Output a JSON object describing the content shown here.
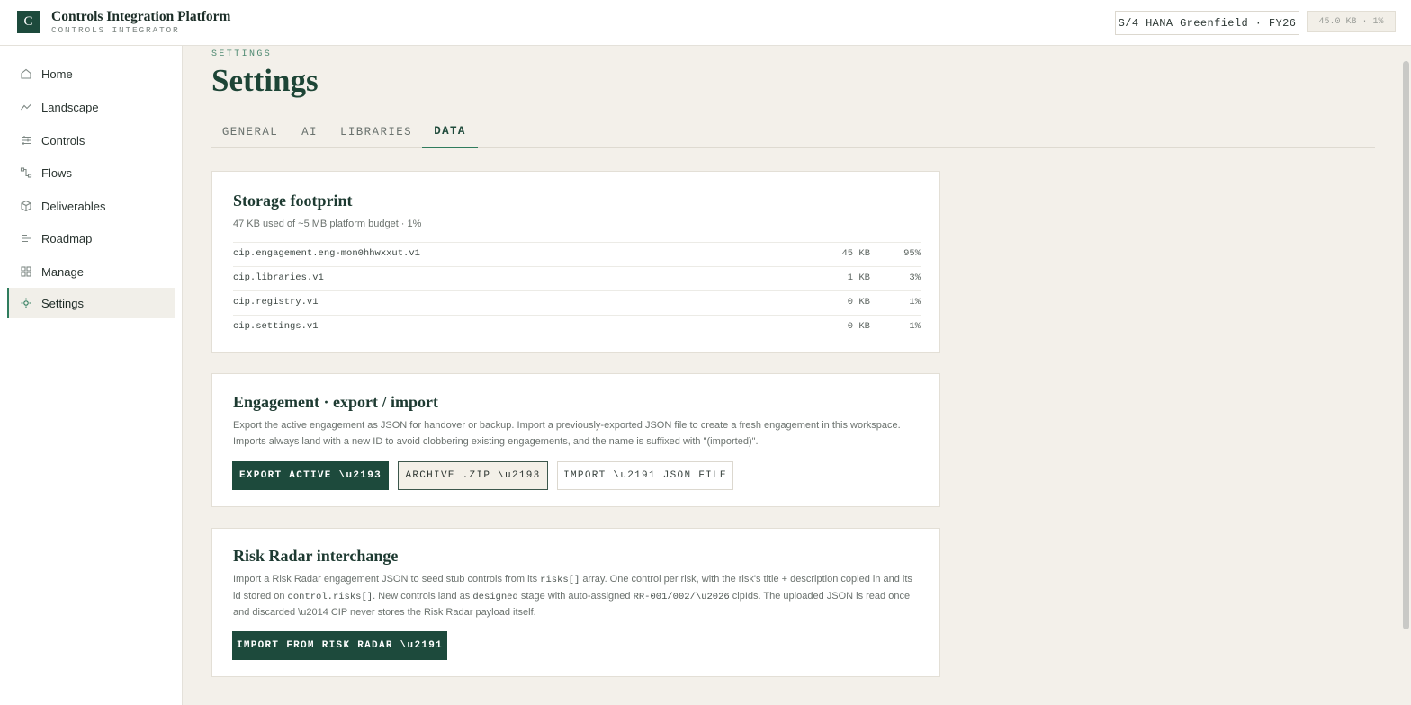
{
  "header": {
    "logo_letter": "C",
    "title": "Controls Integration Platform",
    "subtitle": "CONTROLS INTEGRATOR",
    "environment": "S/4 HANA Greenfield · FY26",
    "storage_badge": "45.0 KB · 1%"
  },
  "sidebar": {
    "items": [
      {
        "label": "Home",
        "icon": "home-icon"
      },
      {
        "label": "Landscape",
        "icon": "landscape-icon"
      },
      {
        "label": "Controls",
        "icon": "sliders-icon"
      },
      {
        "label": "Flows",
        "icon": "flow-icon"
      },
      {
        "label": "Deliverables",
        "icon": "box-icon"
      },
      {
        "label": "Roadmap",
        "icon": "roadmap-icon"
      },
      {
        "label": "Manage",
        "icon": "grid-icon"
      },
      {
        "label": "Settings",
        "icon": "settings-icon",
        "active": true
      }
    ]
  },
  "page": {
    "eyebrow": "SETTINGS",
    "title": "Settings",
    "tabs": [
      {
        "label": "GENERAL"
      },
      {
        "label": "AI"
      },
      {
        "label": "LIBRARIES"
      },
      {
        "label": "DATA",
        "active": true
      }
    ]
  },
  "storage": {
    "title": "Storage footprint",
    "summary": "47 KB used of ~5 MB platform budget · 1%",
    "rows": [
      {
        "key": "cip.engagement.eng-mon0hhwxxut.v1",
        "size": "45 KB",
        "pct": "95%"
      },
      {
        "key": "cip.libraries.v1",
        "size": "1 KB",
        "pct": "3%"
      },
      {
        "key": "cip.registry.v1",
        "size": "0 KB",
        "pct": "1%"
      },
      {
        "key": "cip.settings.v1",
        "size": "0 KB",
        "pct": "1%"
      }
    ]
  },
  "engagement": {
    "title": "Engagement · export / import",
    "description": "Export the active engagement as JSON for handover or backup. Import a previously-exported JSON file to create a fresh engagement in this workspace. Imports always land with a new ID to avoid clobbering existing engagements, and the name is suffixed with \"(imported)\".",
    "export_label": "EXPORT ACTIVE \\u2193",
    "archive_label": "ARCHIVE .ZIP \\u2193",
    "import_label": "IMPORT \\u2191 JSON FILE"
  },
  "risk_radar": {
    "title": "Risk Radar interchange",
    "desc_p1": "Import a Risk Radar engagement JSON to seed stub controls from its ",
    "desc_code1": "risks[]",
    "desc_p2": " array. One control per risk, with the risk's title + description copied in and its id stored on ",
    "desc_code2": "control.risks[]",
    "desc_p3": ". New controls land as ",
    "desc_code3": "designed",
    "desc_p4": " stage with auto-assigned ",
    "desc_code4": "RR-001/002/\\u2026",
    "desc_p5": " cipIds. The uploaded JSON is read once and discarded \\u2014 CIP never stores the Risk Radar payload itself.",
    "import_label": "IMPORT FROM RISK RADAR \\u2191"
  },
  "colors": {
    "brand": "#1d4a3c",
    "accent": "#2f7c5d",
    "background": "#f3f0ea"
  }
}
